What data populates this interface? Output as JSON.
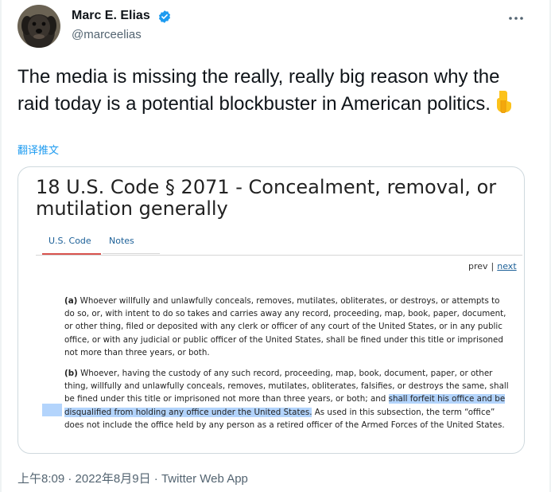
{
  "author": {
    "name": "Marc E. Elias",
    "handle": "@marceelias",
    "avatar_icon": "dog-avatar"
  },
  "tweet": {
    "text": "The media is missing the really, really big reason why the raid today is a potential blockbuster in American politics.",
    "emoji_icon": "backhand-index-pointing-down-icon",
    "translate_label": "翻译推文"
  },
  "card": {
    "title": "18 U.S. Code § 2071 - Concealment, removal, or mutilation generally",
    "tabs": [
      "U.S. Code",
      "Notes"
    ],
    "active_tab": "U.S. Code",
    "pager": {
      "prev": "prev",
      "separator": "|",
      "next": "next"
    },
    "para_a": {
      "marker": "(a)",
      "text": "Whoever willfully and unlawfully conceals, removes, mutilates, obliterates, or destroys, or attempts to do so, or, with intent to do so takes and carries away any record, proceeding, map, book, paper, document, or other thing, filed or deposited with any clerk or officer of any court of the United States, or in any public office, or with any judicial or public officer of the United States, shall be fined under this title or imprisoned not more than three years, or both."
    },
    "para_b": {
      "marker": "(b)",
      "text_before": "Whoever, having the custody of any such record, proceeding, map, book, document, paper, or other thing, willfully and unlawfully conceals, removes, mutilates, obliterates, falsifies, or destroys the same, shall be fined under this title or imprisoned not more than three years, or both; and ",
      "highlighted": "shall forfeit his office and be disqualified from holding any office under the United States.",
      "text_after": " As used in this subsection, the term “office” does not include the office held by any person as a retired officer of the Armed Forces of the United States."
    }
  },
  "meta": {
    "time": "上午8:09",
    "date": "2022年8月9日",
    "separator": "·",
    "source": "Twitter Web App"
  },
  "colors": {
    "accent": "#1d9bf0",
    "muted": "#536471",
    "highlight": "#b3d4fc",
    "tab_active": "#d9534f",
    "link": "#1b5f97"
  }
}
